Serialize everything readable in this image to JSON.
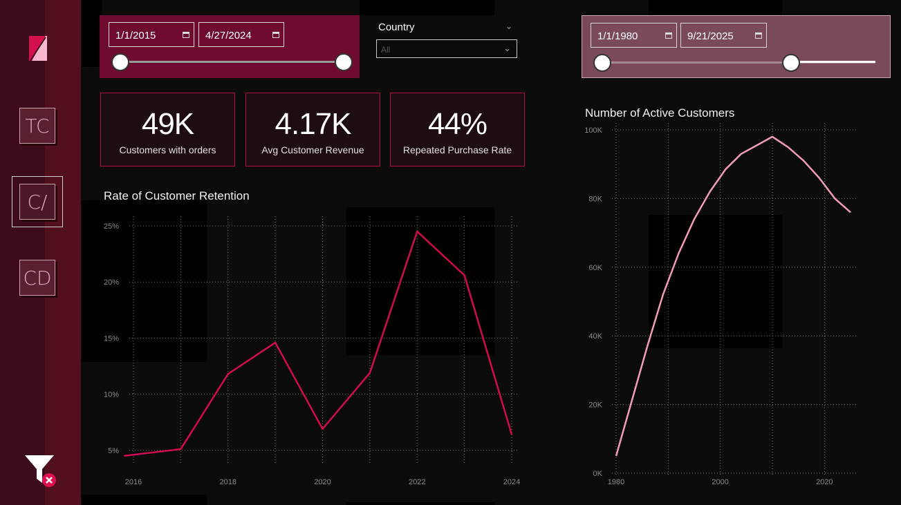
{
  "sidebar": {
    "nav": [
      {
        "label": "TC"
      },
      {
        "label": "C/"
      },
      {
        "label": "CD"
      }
    ]
  },
  "slicer_left": {
    "start_date": "1/1/2015",
    "end_date": "4/27/2024"
  },
  "country_filter": {
    "label": "Country",
    "value": "All"
  },
  "slicer_right": {
    "start_date": "1/1/1980",
    "end_date": "9/21/2025"
  },
  "kpis": [
    {
      "value": "49K",
      "label": "Customers with orders"
    },
    {
      "value": "4.17K",
      "label": "Avg Customer Revenue"
    },
    {
      "value": "44%",
      "label": "Repeated Purchase Rate"
    }
  ],
  "colors": {
    "accent": "#d10a52",
    "line_pink": "#f29bbd",
    "sidebar": "#3d0c1c"
  },
  "chart_data": [
    {
      "type": "line",
      "title": "Rate of Customer Retention",
      "x": [
        2015.8,
        2017,
        2018,
        2019,
        2020,
        2021,
        2022,
        2023,
        2024
      ],
      "y": [
        4.5,
        5.1,
        11.8,
        14.6,
        6.9,
        11.9,
        24.5,
        20.6,
        6.4
      ],
      "xticks": [
        "2016",
        "2018",
        "2020",
        "2022",
        "2024"
      ],
      "yticks": [
        "5%",
        "10%",
        "15%",
        "20%",
        "25%"
      ],
      "xlim": [
        2016,
        2024
      ],
      "ylim": [
        4,
        25
      ],
      "grid": true
    },
    {
      "type": "line",
      "title": "Number of Active Customers",
      "x": [
        1980,
        1983,
        1986,
        1989,
        1992,
        1995,
        1998,
        2001,
        2004,
        2007,
        2010,
        2013,
        2016,
        2019,
        2022,
        2025
      ],
      "y": [
        5000,
        21000,
        37000,
        52000,
        64000,
        74000,
        82000,
        88500,
        93000,
        95500,
        98000,
        95000,
        91000,
        86000,
        80000,
        76000
      ],
      "xticks": [
        "1980",
        "2000",
        "2020"
      ],
      "yticks": [
        "0K",
        "20K",
        "40K",
        "60K",
        "80K",
        "100K"
      ],
      "xlim": [
        1980,
        2025
      ],
      "ylim": [
        0,
        100000
      ],
      "grid": true
    }
  ]
}
